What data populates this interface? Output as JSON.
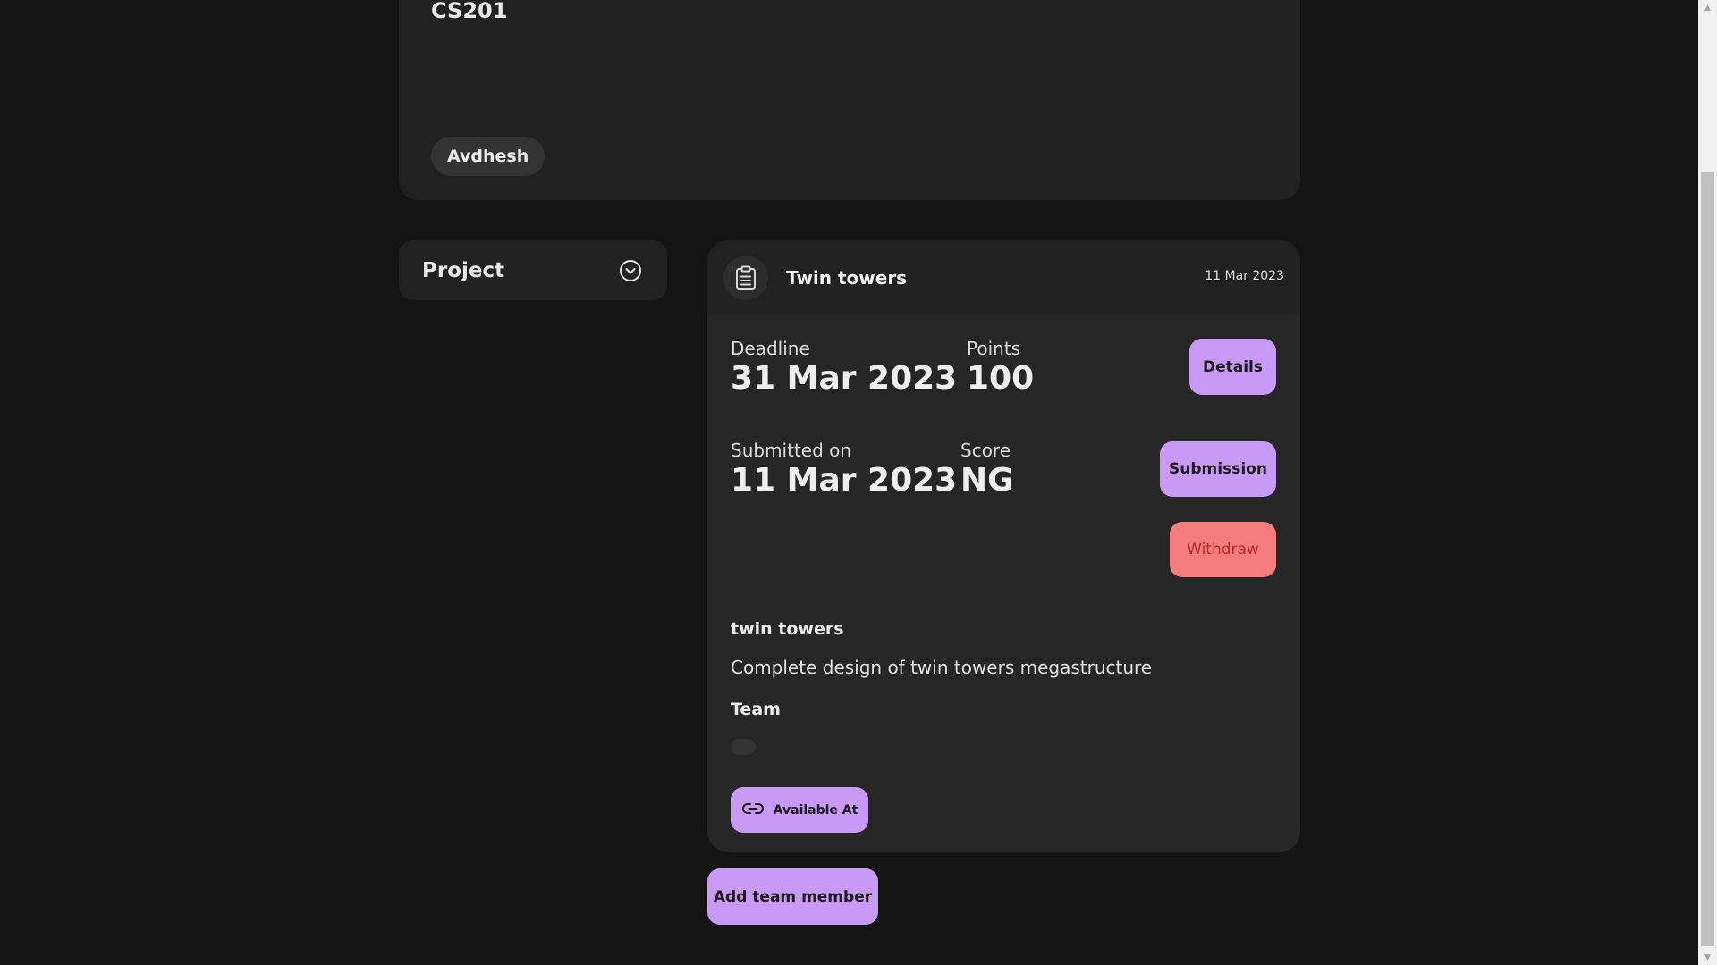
{
  "course": {
    "code": "CS201",
    "teacher": "Avdhesh"
  },
  "sidebar": {
    "dropdown_label": "Project",
    "dropdown_icon": "chevron-down-circle-icon"
  },
  "assignment": {
    "icon": "clipboard-icon",
    "title": "Twin towers",
    "posted_date": "11 Mar 2023",
    "deadline_label": "Deadline",
    "deadline_value": "31 Mar 2023",
    "points_label": "Points",
    "points_value": "100",
    "submitted_label": "Submitted on",
    "submitted_value": "11 Mar 2023",
    "score_label": "Score",
    "score_value": "NG",
    "details_button": "Details",
    "submission_button": "Submission",
    "withdraw_button": "Withdraw",
    "description_title": "twin towers",
    "description_text": "Complete design of twin towers megastructure",
    "team_title": "Team",
    "available_button": "Available At",
    "available_icon": "link-icon"
  },
  "actions": {
    "add_team_member": "Add team member"
  },
  "colors": {
    "background": "#141414",
    "card": "#212121",
    "accent_purple": "#c89af6",
    "danger_bg": "#f47d7d",
    "danger_text": "#c02626"
  }
}
